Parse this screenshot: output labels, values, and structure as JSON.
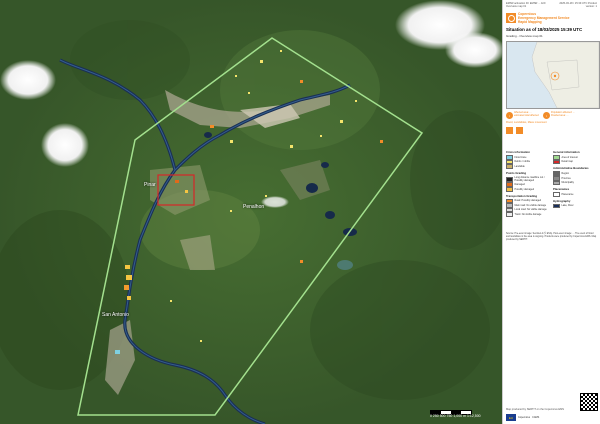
{
  "map": {
    "place_labels": [
      {
        "name": "Pinar"
      },
      {
        "name": "Penalhon"
      },
      {
        "name": "San Antonio"
      }
    ],
    "scale_text": "0 250 500 750 1,000 m   1:12,500"
  },
  "panel": {
    "header_left": "EMSR activation ID: EMSR ... AOI: Overview map 01",
    "header_right": "2025-03-18 / 15:39 UTC Product version: 1",
    "brand": [
      "Copernicus",
      "Emergency Management Service",
      "Rapid Mapping"
    ],
    "title": "Situation as of 18/03/2025 15:39 UTC",
    "subtitle": "Grading - Overview map 01",
    "stats": [
      {
        "icon": "i",
        "text": "Affected area: ... estimated total affected"
      },
      {
        "icon": "i",
        "text": "Population affected: ... Flooded area: ..."
      }
    ],
    "hazard_line": "Flood, Landslides, Mass movement",
    "legend": {
      "left_sections": [
        {
          "heading": "Crisis information",
          "items": [
            {
              "label": "Flood trace",
              "color": "#7fd0e0"
            },
            {
              "label": "Debris / rubble",
              "color": "#f5e46b"
            },
            {
              "label": "Landslide",
              "color": "#c9b06a"
            }
          ]
        },
        {
          "heading": "Points Grading",
          "items": [
            {
              "label": "Long distance road/line not / Possibly damaged",
              "color": "#222222"
            },
            {
              "label": "Damaged",
              "color": "#e06a1a"
            },
            {
              "label": "Possibly damaged",
              "color": "#f2c04a"
            }
          ]
        },
        {
          "heading": "Transportation Grading",
          "items": [
            {
              "label": "Road: Possibly damaged",
              "color": "#f28c28"
            },
            {
              "label": "Main road: No visible damage",
              "color": "#bbbbbb"
            },
            {
              "label": "Local road: No visible damage",
              "color": "#dddddd"
            },
            {
              "label": "Track: No visible damage",
              "color": "#eeeeee"
            }
          ]
        }
      ],
      "right_sections": [
        {
          "heading": "General information",
          "items": [
            {
              "label": "Area of interest",
              "color": "#9fd98f"
            },
            {
              "label": "Detail map",
              "color": "#d62728"
            }
          ]
        },
        {
          "heading": "Administrative Boundaries",
          "items": [
            {
              "label": "Region",
              "color": "#666666"
            },
            {
              "label": "Province",
              "color": "#888888"
            },
            {
              "label": "Municipality",
              "color": "#aaaaaa"
            }
          ]
        },
        {
          "heading": "Placenames",
          "items": [
            {
              "label": "Placename",
              "color": "#ffffff"
            }
          ]
        },
        {
          "heading": "Hydrography",
          "items": [
            {
              "label": "Lake, River",
              "color": "#1a2f5a"
            }
          ]
        }
      ]
    },
    "credits": "Source: Pre-event image: Sentinel-2 (© ESA). Post-event image: ... The event of flood and landslides in the area is ongoing. Products were produced by Copernicus EMS. Map produced by SERTIT.",
    "footer_left": "Map produced by SERTIT on the Copernicus EMS",
    "footer_logos": [
      "EU",
      "Copernicus",
      "CGMS"
    ]
  }
}
